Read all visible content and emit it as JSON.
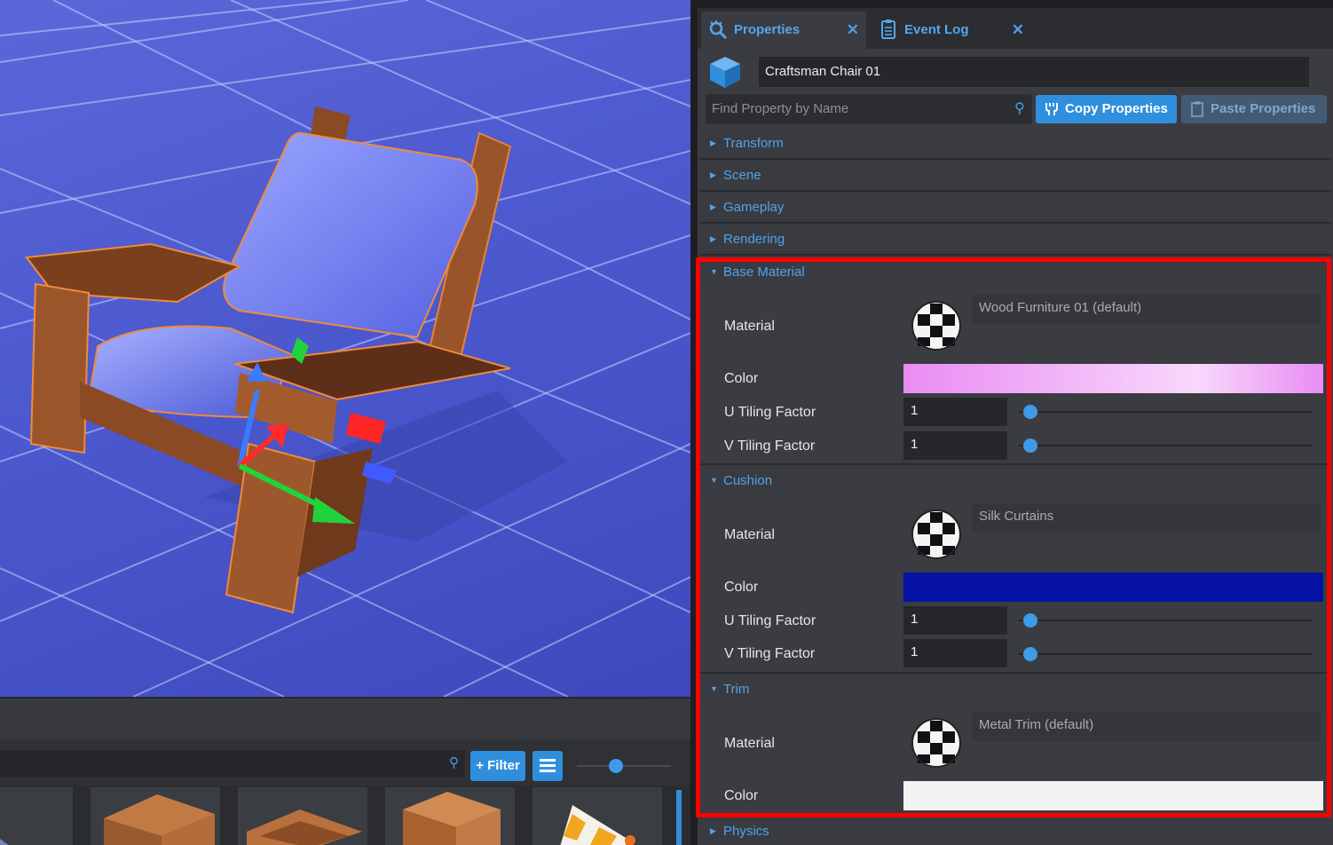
{
  "properties_panel": {
    "tabs": [
      {
        "label": "Properties",
        "icon": "properties-gear-icon",
        "active": true
      },
      {
        "label": "Event Log",
        "icon": "clipboard-icon",
        "active": false
      }
    ],
    "object_name": "Craftsman Chair 01",
    "find_placeholder": "Find Property by Name",
    "copy_label": "Copy Properties",
    "paste_label": "Paste Properties",
    "sections": {
      "transform": "Transform",
      "scene": "Scene",
      "gameplay": "Gameplay",
      "rendering": "Rendering",
      "physics": "Physics"
    },
    "base_material": {
      "title": "Base Material",
      "material_label": "Material",
      "material_value": "Wood Furniture 01 (default)",
      "color_label": "Color",
      "color": [
        "#e98cf3",
        "#f8d8fb"
      ],
      "u_label": "U Tiling Factor",
      "u_value": "1",
      "v_label": "V Tiling Factor",
      "v_value": "1"
    },
    "cushion": {
      "title": "Cushion",
      "material_label": "Material",
      "material_value": "Silk Curtains",
      "color_label": "Color",
      "color": "#0512a3",
      "u_label": "U Tiling Factor",
      "u_value": "1",
      "v_label": "V Tiling Factor",
      "v_value": "1"
    },
    "trim": {
      "title": "Trim",
      "material_label": "Material",
      "material_value": "Metal Trim (default)",
      "color_label": "Color",
      "color": "#f2f2f2"
    }
  },
  "asset_browser": {
    "filter_label": "+ Filter"
  },
  "colors": {
    "accent": "#2f8fdc",
    "highlight": "#ff0000"
  }
}
